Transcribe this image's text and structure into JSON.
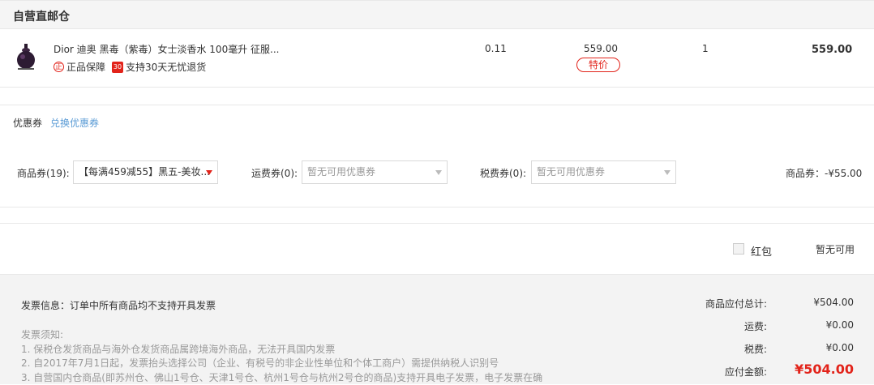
{
  "warehouse": {
    "title": "自营直邮仓"
  },
  "product": {
    "name": "Dior 迪奥 黑毒（紫毒）女士淡香水 100毫升 征服...",
    "tags": [
      {
        "icon_text": "正",
        "label": "正品保障"
      },
      {
        "icon_text": "30",
        "label": "支持30天无忧退货"
      }
    ],
    "weight": "0.11",
    "price": "559.00",
    "badge": "特价",
    "quantity": "1",
    "subtotal": "559.00"
  },
  "coupons": {
    "title": "优惠券",
    "exchange_link": "兑换优惠券",
    "goods_label": "商品券(19):",
    "goods_selected": "【每满459减55】黑五-美妆...",
    "shipping_label": "运费券(0):",
    "shipping_placeholder": "暂无可用优惠券",
    "tax_label": "税费券(0):",
    "tax_placeholder": "暂无可用优惠券",
    "goods_discount": "商品券：-¥55.00"
  },
  "red_packet": {
    "label": "红包",
    "status": "暂无可用"
  },
  "invoice": {
    "info": "发票信息：订单中所有商品均不支持开具发票",
    "notice_title": "发票须知:",
    "notice_lines": [
      "1. 保税仓发货商品与海外仓发货商品属跨境海外商品，无法开具国内发票",
      "2. 自2017年7月1日起，发票抬头选择公司（企业、有税号的非企业性单位和个体工商户）需提供纳税人识别号",
      "3. 自营国内仓商品(即苏州仓、佛山1号仓、天津1号仓、杭州1号仓与杭州2号仓的商品)支持开具电子发票，电子发票在确"
    ]
  },
  "summary": {
    "goods_total_label": "商品应付总计:",
    "goods_total": "¥504.00",
    "shipping_label": "运费:",
    "shipping": "¥0.00",
    "tax_label": "税费:",
    "tax": "¥0.00",
    "payable_label": "应付金额:",
    "payable": "¥504.00"
  },
  "colors": {
    "accent": "#e2231a",
    "link": "#5a9bd5"
  }
}
